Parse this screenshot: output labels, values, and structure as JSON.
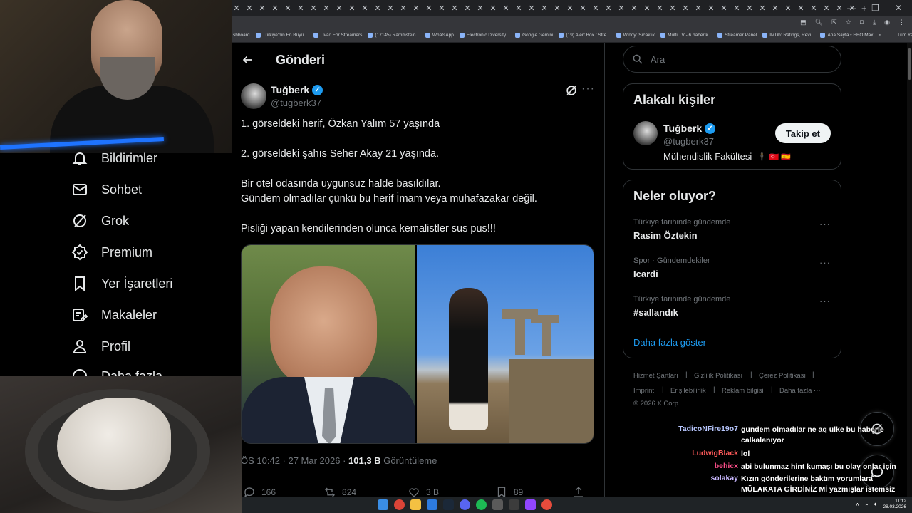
{
  "browser": {
    "tabs_count": 49,
    "bookmarks": [
      "shboard",
      "Türkiye'nin En Büyü...",
      "Livad For Streamers",
      "(17145) Rammstein...",
      "WhatsApp",
      "Electronic Diversity...",
      "Google Gemini",
      "(19) Alert Box / Stre...",
      "Windy: Sıcaklık",
      "Multi TV - 6 haber k...",
      "Streamer Panel",
      "IMDb: Ratings, Revi...",
      "Ana Sayfa • HBO Max"
    ],
    "bookmarks_more": "»",
    "all_bookmarks": "Tüm Yer İşaretleri"
  },
  "nav": {
    "items": [
      {
        "label": "Bildirimler",
        "icon": "bell-icon"
      },
      {
        "label": "Sohbet",
        "icon": "mail-icon"
      },
      {
        "label": "Grok",
        "icon": "grok-icon"
      },
      {
        "label": "Premium",
        "icon": "verified-badge-icon"
      },
      {
        "label": "Yer İşaretleri",
        "icon": "bookmark-icon"
      },
      {
        "label": "Makaleler",
        "icon": "article-icon"
      },
      {
        "label": "Profil",
        "icon": "person-icon"
      },
      {
        "label": "Daha fazla",
        "icon": "more-circle-icon"
      }
    ]
  },
  "post": {
    "header_title": "Gönderi",
    "author_name": "Tuğberk",
    "author_handle": "@tugberk37",
    "lines": [
      "1. görseldeki herif, Özkan Yalım 57 yaşında",
      "2. görseldeki şahıs Seher Akay 21 yaşında.",
      "Bir otel odasında uygunsuz halde basıldılar.",
      "Gündem olmadılar çünkü bu herif İmam veya muhafazakar değil.",
      "Pisliği yapan kendilerinden olunca kemalistler sus pus!!!"
    ],
    "time": "ÖS 10:42 · 27 Mar 2026 · ",
    "views_count": "101,3 B",
    "views_label": "Görüntüleme",
    "replies": "166",
    "reposts": "824",
    "likes": "3 B",
    "bookmarks": "89"
  },
  "sidebar": {
    "search_placeholder": "Ara",
    "related_title": "Alakalı kişiler",
    "related_name": "Tuğberk",
    "related_handle": "@tugberk37",
    "related_bio": "Mühendislik Fakültesi",
    "bio_emojis": "🕴 🇹🇷 🇪🇸",
    "follow_label": "Takip et",
    "trends_title": "Neler oluyor?",
    "trends": [
      {
        "meta": "Türkiye tarihinde gündemde",
        "name": "Rasim Öztekin"
      },
      {
        "meta": "Spor · Gündemdekiler",
        "name": "Icardi"
      },
      {
        "meta": "Türkiye tarihinde gündemde",
        "name": "#sallandık"
      }
    ],
    "show_more": "Daha fazla göster",
    "footer": [
      "Hizmet Şartları",
      "Gizlilik Politikası",
      "Çerez Politikası",
      "Imprint",
      "Erişilebilirlik",
      "Reklam bilgisi",
      "Daha fazla ···"
    ],
    "copyright": "© 2026 X Corp."
  },
  "chat": [
    {
      "user": "TadicoNFire19o7",
      "color": "#b8c7ff",
      "msg": "gündem olmadılar ne aq ülke bu haberle calkalanıyor"
    },
    {
      "user": "LudwigBlack",
      "color": "#ff5a5a",
      "msg": "lol"
    },
    {
      "user": "behicx",
      "color": "#ff4f8b",
      "msg": "abi bulunmaz hint kumaşı bu olay onlar için"
    },
    {
      "user": "solakay",
      "color": "#c9b8ff",
      "msg": "Kızın gönderilerine baktım yorumlara MÜLAKATA GİRDİNİZ Mİ yazmışlar istemsiz koptum amk"
    }
  ],
  "taskbar": {
    "time": "11:12",
    "date": "28.03.2026"
  },
  "colors": {
    "accent": "#1d9bf0",
    "background": "#000000",
    "border": "#2f3336",
    "muted": "#71767b"
  }
}
